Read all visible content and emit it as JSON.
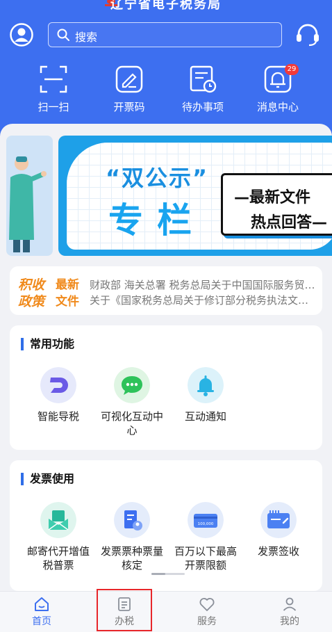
{
  "app": {
    "title": "辽宁省电子税务局"
  },
  "search": {
    "placeholder": "搜索"
  },
  "quick_actions": [
    {
      "label": "扫一扫",
      "icon": "scan-icon"
    },
    {
      "label": "开票码",
      "icon": "invoice-code-icon"
    },
    {
      "label": "待办事项",
      "icon": "todo-icon"
    },
    {
      "label": "消息中心",
      "icon": "bell-icon",
      "badge": "29"
    }
  ],
  "banner": {
    "quote_text": "“双公示”",
    "main_text": "专栏",
    "box_line1": "—最新文件",
    "box_line2": "热点回答—"
  },
  "news": {
    "logo_line1_a": "积收",
    "logo_line1_b": "最新",
    "logo_line2_a": "政策",
    "logo_line2_b": "文件",
    "items": [
      "财政部 海关总署 税务总局关于中国国际服务贸易交易会展期内销售的进口展品税收政策的通知",
      "关于《国家税务总局关于修订部分税务执法文书式样的公告》的解读"
    ]
  },
  "common_functions": {
    "title": "常用功能",
    "items": [
      {
        "label": "智能导税",
        "icon": "smart-guide-icon"
      },
      {
        "label": "可视化互动中心",
        "icon": "chat-icon"
      },
      {
        "label": "互动通知",
        "icon": "notify-bell-icon"
      }
    ]
  },
  "invoice_use": {
    "title": "发票使用",
    "items": [
      {
        "label": "邮寄代开增值税普票",
        "icon": "mail-invoice-icon"
      },
      {
        "label": "发票票种票量核定",
        "icon": "invoice-verify-icon"
      },
      {
        "label": "百万以下最高开票限额",
        "icon": "limit-card-icon",
        "card_text": "100,000"
      },
      {
        "label": "发票签收",
        "icon": "invoice-receive-icon"
      }
    ]
  },
  "tabbar": [
    {
      "label": "首页",
      "icon": "home-icon",
      "active": true
    },
    {
      "label": "办税",
      "icon": "tax-document-icon",
      "active": false
    },
    {
      "label": "服务",
      "icon": "heart-icon",
      "active": false
    },
    {
      "label": "我的",
      "icon": "user-icon",
      "active": false
    }
  ],
  "colors": {
    "primary": "#3d6ff0",
    "badge": "#f23a3a",
    "highlight_border": "#e8262a"
  }
}
